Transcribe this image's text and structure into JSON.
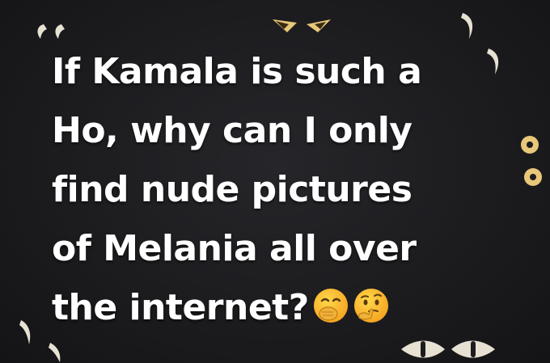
{
  "post": {
    "lines": [
      "If Kamala is such a",
      "Ho, why can I only",
      "find nude pictures",
      "of Melania all over",
      "the internet?"
    ],
    "trailing_emojis": [
      "face-with-hand-over-mouth-icon",
      "thinking-face-icon"
    ]
  },
  "colors": {
    "background": "#1c1c1f",
    "text": "#ffffff",
    "eyes": "#e8c77a"
  }
}
